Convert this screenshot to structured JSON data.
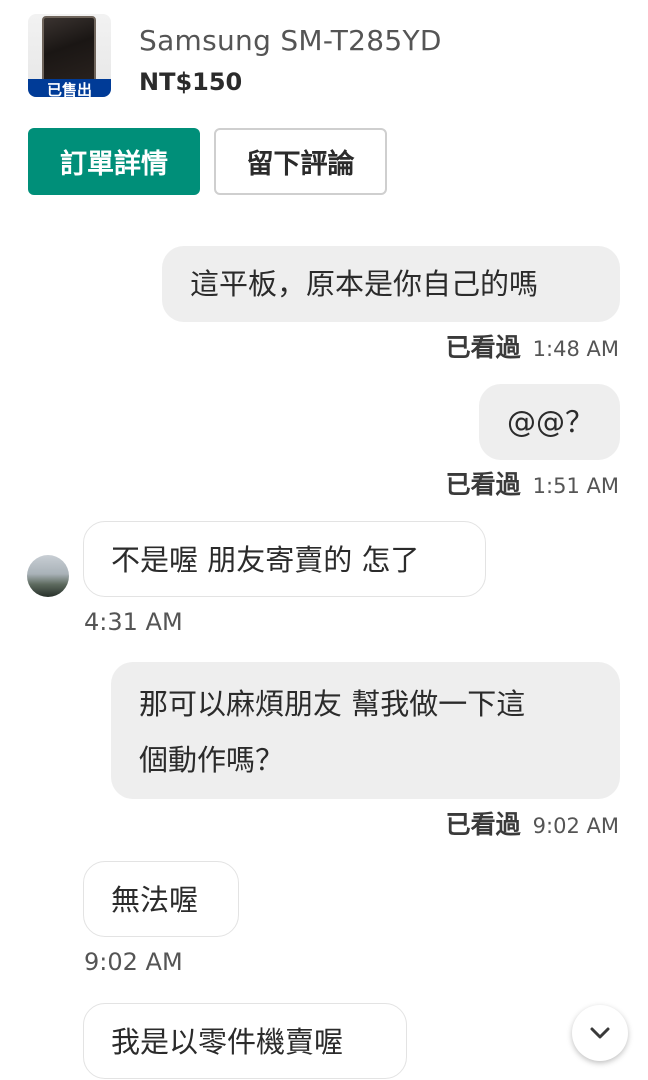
{
  "listing": {
    "title": "Samsung SM-T285YD",
    "price": "NT$150",
    "sold_badge": "已售出"
  },
  "actions": {
    "order_details": "訂單詳情",
    "leave_review": "留下評論"
  },
  "messages": [
    {
      "direction": "out",
      "lines": [
        "這平板，原本是你自己的嗎"
      ],
      "status": "已看過",
      "time": "1:48 AM"
    },
    {
      "direction": "out",
      "lines": [
        "@@？"
      ],
      "status": "已看過",
      "time": "1:51 AM"
    },
    {
      "direction": "in",
      "lines": [
        "不是喔 朋友寄賣的 怎了"
      ],
      "time": "4:31 AM"
    },
    {
      "direction": "out",
      "lines": [
        "那可以麻煩朋友 幫我做一下這",
        "個動作嗎？"
      ],
      "status": "已看過",
      "time": "9:02 AM"
    },
    {
      "direction": "in",
      "lines": [
        "無法喔"
      ],
      "time": "9:02 AM"
    },
    {
      "direction": "in",
      "lines": [
        "我是以零件機賣喔"
      ]
    }
  ],
  "icons": {
    "scroll": "chevron-down-icon",
    "avatar": "avatar"
  }
}
